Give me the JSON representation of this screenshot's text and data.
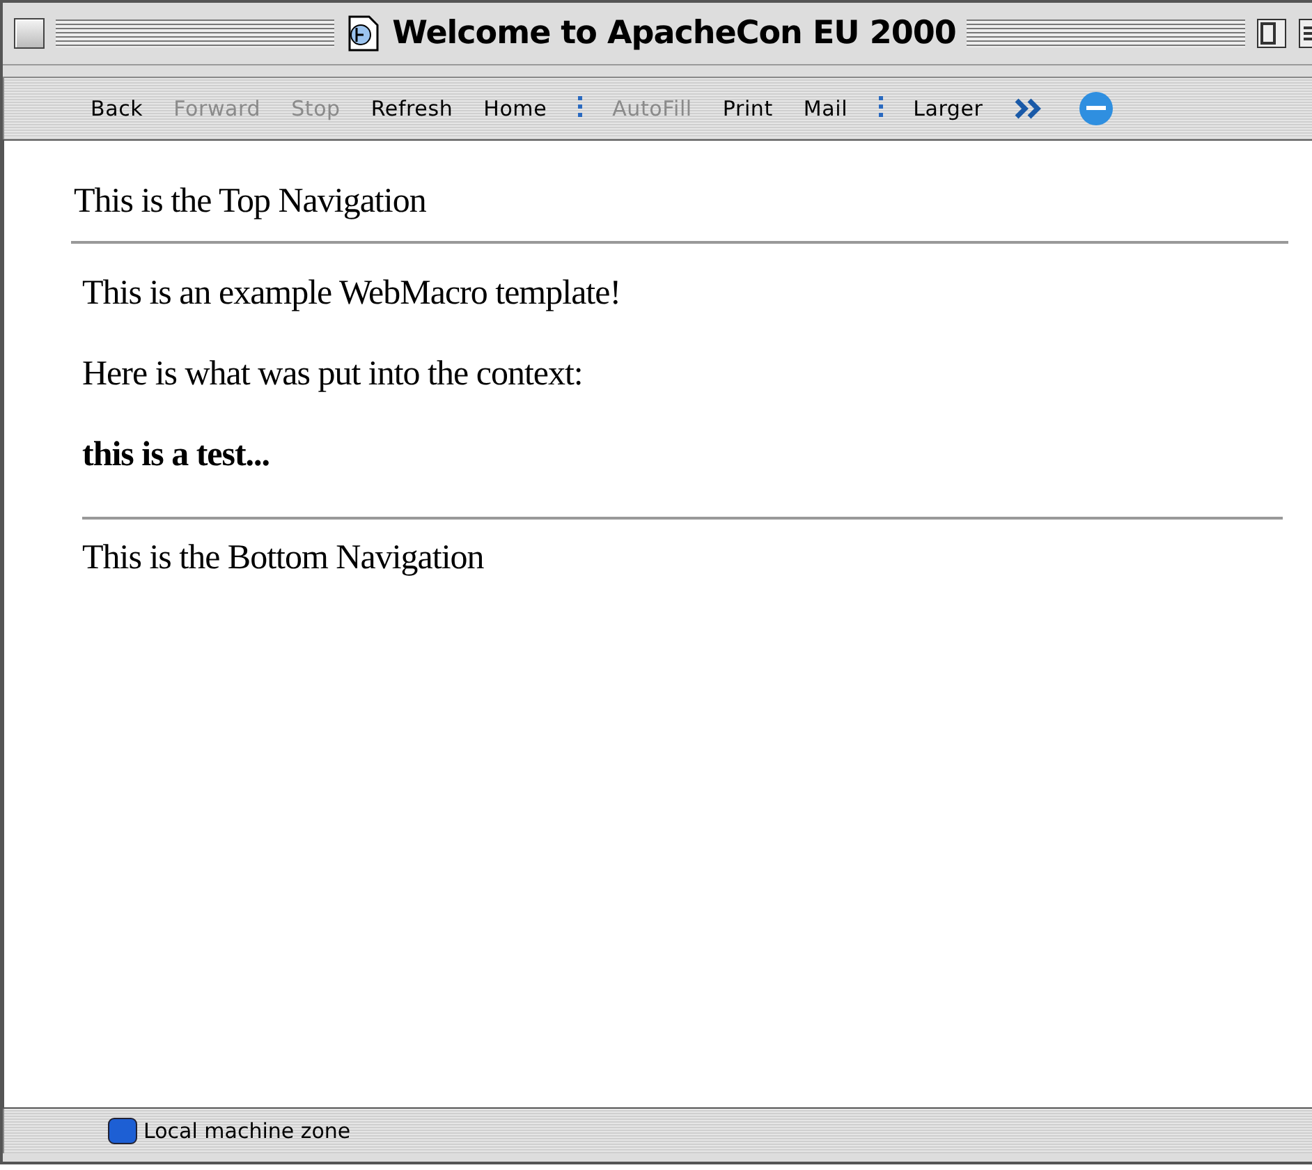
{
  "window": {
    "title": "Welcome to ApacheCon EU 2000"
  },
  "toolbar": {
    "items": [
      {
        "kind": "button",
        "label": "Back",
        "disabled": false
      },
      {
        "kind": "button",
        "label": "Forward",
        "disabled": true
      },
      {
        "kind": "button",
        "label": "Stop",
        "disabled": true
      },
      {
        "kind": "button",
        "label": "Refresh",
        "disabled": false
      },
      {
        "kind": "button",
        "label": "Home",
        "disabled": false
      },
      {
        "kind": "separator"
      },
      {
        "kind": "button",
        "label": "AutoFill",
        "disabled": true
      },
      {
        "kind": "button",
        "label": "Print",
        "disabled": false
      },
      {
        "kind": "button",
        "label": "Mail",
        "disabled": false
      },
      {
        "kind": "separator"
      },
      {
        "kind": "button",
        "label": "Larger",
        "disabled": false
      },
      {
        "kind": "more"
      }
    ]
  },
  "page": {
    "top_navigation": "This is the Top Navigation",
    "blocks": [
      {
        "kind": "text",
        "text": "This is an example WebMacro template!"
      },
      {
        "kind": "text",
        "text": "Here is what was put into the context:"
      },
      {
        "kind": "bold",
        "text": "this is a test..."
      }
    ],
    "bottom_navigation": "This is the Bottom Navigation"
  },
  "status_bar": {
    "zone": "Local machine zone"
  }
}
